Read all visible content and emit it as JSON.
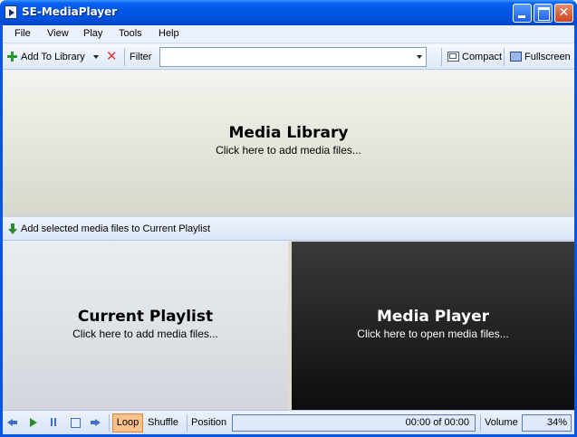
{
  "window": {
    "title": "SE-MediaPlayer"
  },
  "menu": [
    "File",
    "View",
    "Play",
    "Tools",
    "Help"
  ],
  "toolbar": {
    "add_to_library": "Add To Library",
    "filter_label": "Filter",
    "filter_value": "",
    "compact": "Compact",
    "fullscreen": "Fullscreen"
  },
  "library": {
    "title": "Media Library",
    "subtitle": "Click here to add media files..."
  },
  "add_bar": {
    "label": "Add selected media files to Current Playlist"
  },
  "playlist": {
    "title": "Current Playlist",
    "subtitle": "Click here to add media files..."
  },
  "player": {
    "title": "Media Player",
    "subtitle": "Click here to open media files..."
  },
  "transport": {
    "loop": "Loop",
    "shuffle": "Shuffle",
    "position_label": "Position",
    "time": "00:00 of 00:00",
    "volume_label": "Volume",
    "volume_value": "34%",
    "volume_level": 0.34
  },
  "colors": {
    "titlebar": "#0055e5",
    "loop_active": "#fbc18b",
    "player_bg": "#1a1a1a"
  }
}
